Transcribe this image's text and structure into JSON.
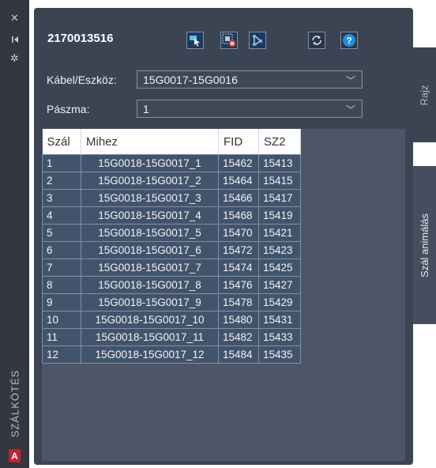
{
  "side_strip": {
    "close_icon": "close-icon",
    "pin_icon": "pin-icon",
    "settings_icon": "gear-icon",
    "vertical_label": "SZÁLKÖTÉS",
    "app_logo_letter": "A"
  },
  "header": {
    "fid_value": "2170013516",
    "toolbar": [
      {
        "name": "select-object-button",
        "icon": "select-arrow-icon"
      },
      {
        "name": "remove-button",
        "icon": "delete-icon"
      },
      {
        "name": "connection-button",
        "icon": "network-icon"
      },
      {
        "name": "refresh-button",
        "icon": "refresh-icon"
      },
      {
        "name": "help-button",
        "icon": "help-icon"
      }
    ]
  },
  "form": {
    "kabel_label": "Kábel/Eszköz:",
    "kabel_value": "15G0017-15G0016",
    "paszma_label": "Pászma:",
    "paszma_value": "1"
  },
  "grid": {
    "columns": [
      "Szál",
      "Mihez",
      "FID",
      "SZ2"
    ],
    "rows": [
      [
        "1",
        "15G0018-15G0017_1",
        "15462",
        "15413"
      ],
      [
        "2",
        "15G0018-15G0017_2",
        "15464",
        "15415"
      ],
      [
        "3",
        "15G0018-15G0017_3",
        "15466",
        "15417"
      ],
      [
        "4",
        "15G0018-15G0017_4",
        "15468",
        "15419"
      ],
      [
        "5",
        "15G0018-15G0017_5",
        "15470",
        "15421"
      ],
      [
        "6",
        "15G0018-15G0017_6",
        "15472",
        "15423"
      ],
      [
        "7",
        "15G0018-15G0017_7",
        "15474",
        "15425"
      ],
      [
        "8",
        "15G0018-15G0017_8",
        "15476",
        "15427"
      ],
      [
        "9",
        "15G0018-15G0017_9",
        "15478",
        "15429"
      ],
      [
        "10",
        "15G0018-15G0017_10",
        "15480",
        "15431"
      ],
      [
        "11",
        "15G0018-15G0017_11",
        "15482",
        "15433"
      ],
      [
        "12",
        "15G0018-15G0017_12",
        "15484",
        "15435"
      ]
    ]
  },
  "tabs": {
    "rajz": "Rajz",
    "szal_animalas": "Szál animálás"
  }
}
